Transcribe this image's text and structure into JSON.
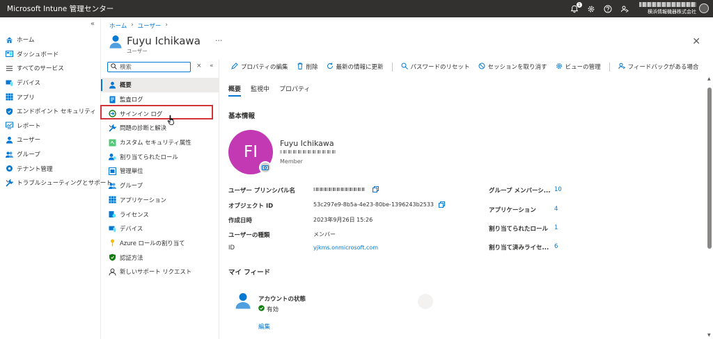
{
  "topbar": {
    "brand": "Microsoft Intune 管理センター",
    "notification_count": "1",
    "org": "横浜情報機器株式会社"
  },
  "leftnav": {
    "items": [
      {
        "label": "ホーム",
        "icon": "home-icon"
      },
      {
        "label": "ダッシュボード",
        "icon": "dashboard-icon"
      },
      {
        "label": "すべてのサービス",
        "icon": "list-icon"
      },
      {
        "label": "デバイス",
        "icon": "devices-icon"
      },
      {
        "label": "アプリ",
        "icon": "apps-icon"
      },
      {
        "label": "エンドポイント セキュリティ",
        "icon": "shield-icon"
      },
      {
        "label": "レポート",
        "icon": "report-icon"
      },
      {
        "label": "ユーザー",
        "icon": "user-icon"
      },
      {
        "label": "グループ",
        "icon": "group-icon"
      },
      {
        "label": "テナント管理",
        "icon": "tenant-icon"
      },
      {
        "label": "トラブルシューティングとサポート",
        "icon": "wrench-icon"
      }
    ]
  },
  "breadcrumb": [
    "ホーム",
    "ユーザー"
  ],
  "header": {
    "title": "Fuyu Ichikawa",
    "subtitle": "ユーザー",
    "more": "···",
    "close": "✕"
  },
  "resource_menu": {
    "search_placeholder": "検索",
    "items": [
      {
        "label": "概要",
        "icon": "user-icon",
        "active": true
      },
      {
        "label": "監査ログ",
        "icon": "audit-log-icon"
      },
      {
        "label": "サインイン ログ",
        "icon": "signin-log-icon"
      },
      {
        "label": "問題の診断と解決",
        "icon": "wrench-icon"
      },
      {
        "label": "カスタム セキュリティ属性",
        "icon": "custom-attributes-icon"
      },
      {
        "label": "割り当てられたロール",
        "icon": "roles-icon"
      },
      {
        "label": "管理単位",
        "icon": "admin-units-icon"
      },
      {
        "label": "グループ",
        "icon": "group-icon"
      },
      {
        "label": "アプリケーション",
        "icon": "apps-icon"
      },
      {
        "label": "ライセンス",
        "icon": "license-icon"
      },
      {
        "label": "デバイス",
        "icon": "devices-icon"
      },
      {
        "label": "Azure ロールの割り当て",
        "icon": "key-icon"
      },
      {
        "label": "認証方法",
        "icon": "auth-icon"
      },
      {
        "label": "新しいサポート リクエスト",
        "icon": "support-icon"
      }
    ]
  },
  "commands": [
    {
      "label": "プロパティの編集",
      "icon": "edit-icon"
    },
    {
      "label": "削除",
      "icon": "trash-icon"
    },
    {
      "label": "最新の情報に更新",
      "icon": "refresh-icon"
    },
    {
      "label": "パスワードのリセット",
      "icon": "key-reset-icon"
    },
    {
      "label": "セッションを取り消す",
      "icon": "revoke-icon"
    },
    {
      "label": "ビューの管理",
      "icon": "gear-icon"
    },
    {
      "label": "フィードバックがある場合",
      "icon": "feedback-icon"
    }
  ],
  "tabs": [
    "概要",
    "監視中",
    "プロパティ"
  ],
  "basic_info": {
    "title": "基本情報",
    "initials": "FI",
    "name": "Fuyu Ichikawa",
    "role": "Member",
    "fields": [
      {
        "label": "ユーザー プリンシパル名",
        "value": ""
      },
      {
        "label": "オブジェクト ID",
        "value": "53c297e9-8b5a-4e23-80be-1396243b2533"
      },
      {
        "label": "作成日時",
        "value": "2023年9月26日 15:26"
      },
      {
        "label": "ユーザーの種類",
        "value": "メンバー"
      },
      {
        "label": "ID",
        "value": "yjkms.onmicrosoft.com"
      }
    ],
    "stats": [
      {
        "label": "グループ メンバーシ...",
        "value": "10"
      },
      {
        "label": "アプリケーション",
        "value": "4"
      },
      {
        "label": "割り当てられたロール",
        "value": "1"
      },
      {
        "label": "割り当て済みライセ...",
        "value": "6"
      }
    ]
  },
  "feed": {
    "title": "マイ フィード",
    "card_title": "アカウントの状態",
    "status": "有効",
    "edit": "編集"
  }
}
